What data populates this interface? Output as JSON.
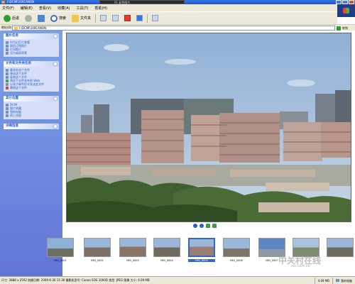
{
  "window": {
    "title": "I:\\DCIM\\100CANON",
    "taskbar_tab": "01 彩色图片"
  },
  "menu": [
    "文件(F)",
    "编辑(E)",
    "查看(V)",
    "收藏(A)",
    "工具(T)",
    "帮助(H)"
  ],
  "toolbar": {
    "back": "后退",
    "search": "搜索",
    "folders": "文件夹"
  },
  "address": {
    "label": "地址(D)",
    "value": "I:\\DCIM\\100CANON",
    "go": "转到"
  },
  "taskpane": {
    "groups": [
      {
        "title": "图片任务",
        "items": [
          "作为幻灯片查看",
          "联机订购照片",
          "打印图片",
          "设为桌面背景"
        ]
      },
      {
        "title": "文件和文件夹任务",
        "items": [
          "重命名这个文件",
          "移动这个文件",
          "复制这个文件",
          "将这个文件发布到 Web",
          "以电子邮件形式发送此文件",
          "删除这个文件"
        ]
      },
      {
        "title": "其它位置",
        "items": [
          "DCIM",
          "图片收藏",
          "我的电脑",
          "网上邻居"
        ]
      },
      {
        "title": "详细信息",
        "items": []
      }
    ]
  },
  "filmstrip": [
    {
      "caption": "IMG_0001",
      "selected": false
    },
    {
      "caption": "IMG_0002",
      "selected": false
    },
    {
      "caption": "IMG_0003",
      "selected": false
    },
    {
      "caption": "IMG_0004",
      "selected": false
    },
    {
      "caption": "IMG_0005",
      "selected": true
    },
    {
      "caption": "IMG_0006",
      "selected": false
    },
    {
      "caption": "IMG_0007",
      "selected": false
    },
    {
      "caption": "",
      "selected": false
    },
    {
      "caption": "",
      "selected": false
    }
  ],
  "status": {
    "details": "尺寸: 3888 x 2592 拍摄日期: 2009-6-30 11:36 摄影机型号: Canon EOS 1000D 类型: JPEG 图像 大小: 4.09 MB",
    "size": "4.09 MB",
    "location": "我的电脑"
  },
  "watermark": {
    "main": "中关村在线",
    "sub": "zol.com.cn"
  },
  "colors": {
    "title_bar": "#1f55c8",
    "task_pane": "#6375d6",
    "selection": "#316ac5"
  }
}
